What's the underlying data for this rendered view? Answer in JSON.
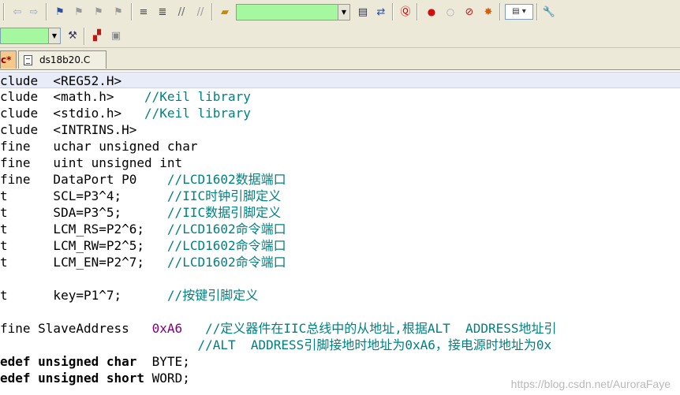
{
  "toolbar1": {
    "target_combo_value": "",
    "buttons": [
      "indent-icon",
      "unindent-icon",
      "comment-icon",
      "uncomment-icon"
    ]
  },
  "toolbar2": {
    "target_select_value": ""
  },
  "tabs": [
    {
      "label": "c*",
      "active": true
    },
    {
      "label": "ds18b20.C",
      "active": false
    }
  ],
  "code_lines": [
    {
      "segments": [
        {
          "t": "clude  <REG52.H>",
          "c": ""
        }
      ],
      "highlight": true
    },
    {
      "segments": [
        {
          "t": "clude  <math.h>    ",
          "c": ""
        },
        {
          "t": "//Keil library",
          "c": "cm"
        }
      ]
    },
    {
      "segments": [
        {
          "t": "clude  <stdio.h>   ",
          "c": ""
        },
        {
          "t": "//Keil library",
          "c": "cm"
        }
      ]
    },
    {
      "segments": [
        {
          "t": "clude  <INTRINS.H>",
          "c": ""
        }
      ]
    },
    {
      "segments": [
        {
          "t": "fine   uchar unsigned char",
          "c": ""
        }
      ]
    },
    {
      "segments": [
        {
          "t": "fine   uint unsigned int",
          "c": ""
        }
      ]
    },
    {
      "segments": [
        {
          "t": "fine   DataPort P0    ",
          "c": ""
        },
        {
          "t": "//LCD1602数据端口",
          "c": "cm"
        }
      ]
    },
    {
      "segments": [
        {
          "t": "t      SCL=P3^4;      ",
          "c": ""
        },
        {
          "t": "//IIC时钟引脚定义",
          "c": "cm"
        }
      ]
    },
    {
      "segments": [
        {
          "t": "t      SDA=P3^5;      ",
          "c": ""
        },
        {
          "t": "//IIC数据引脚定义",
          "c": "cm"
        }
      ]
    },
    {
      "segments": [
        {
          "t": "t      LCM_RS=P2^6;   ",
          "c": ""
        },
        {
          "t": "//LCD1602命令端口",
          "c": "cm"
        }
      ]
    },
    {
      "segments": [
        {
          "t": "t      LCM_RW=P2^5;   ",
          "c": ""
        },
        {
          "t": "//LCD1602命令端口",
          "c": "cm"
        }
      ]
    },
    {
      "segments": [
        {
          "t": "t      LCM_EN=P2^7;   ",
          "c": ""
        },
        {
          "t": "//LCD1602命令端口",
          "c": "cm"
        }
      ]
    },
    {
      "segments": [
        {
          "t": "",
          "c": ""
        }
      ]
    },
    {
      "segments": [
        {
          "t": "t      key=P1^7;      ",
          "c": ""
        },
        {
          "t": "//按键引脚定义",
          "c": "cm"
        }
      ]
    },
    {
      "segments": [
        {
          "t": "",
          "c": ""
        }
      ]
    },
    {
      "segments": [
        {
          "t": "fine SlaveAddress   ",
          "c": ""
        },
        {
          "t": "0xA6",
          "c": "num"
        },
        {
          "t": "   ",
          "c": ""
        },
        {
          "t": "//定义器件在IIC总线中的从地址,根据ALT  ADDRESS地址引",
          "c": "cm"
        }
      ]
    },
    {
      "segments": [
        {
          "t": "                          ",
          "c": ""
        },
        {
          "t": "//ALT  ADDRESS引脚接地时地址为0xA6，接电源时地址为0x",
          "c": "cm"
        }
      ]
    },
    {
      "segments": [
        {
          "t": "edef unsigned char",
          "c": "bold"
        },
        {
          "t": "  BYTE;",
          "c": ""
        }
      ]
    },
    {
      "segments": [
        {
          "t": "edef unsigned short",
          "c": "bold"
        },
        {
          "t": " WORD;",
          "c": ""
        }
      ]
    }
  ],
  "watermark": "https://blog.csdn.net/AuroraFaye",
  "colors": {
    "comment": "#008080",
    "number": "#800080",
    "combo_bg": "#a5f8a0",
    "active_tab_bg": "#f5c98a",
    "toolbar_bg": "#ece9d8"
  }
}
